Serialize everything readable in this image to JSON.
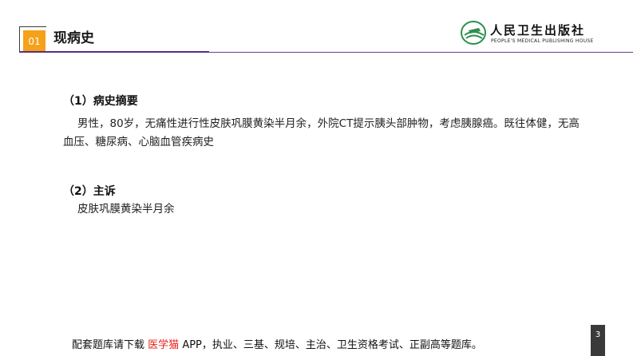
{
  "header": {
    "section_number": "01",
    "section_title": "现病史",
    "colors": {
      "accent_orange": "#f5a11a",
      "rule_purple": "#5b2d83"
    }
  },
  "logo": {
    "icon": "book-emblem-icon",
    "cn_name": "人民卫生出版社",
    "en_name": "PEOPLE'S MEDICAL PUBLISHING HOUSE"
  },
  "content": {
    "section1": {
      "heading": "（1）病史摘要",
      "text": "男性，80岁，无痛性进行性皮肤巩膜黄染半月余，外院CT提示胰头部肿物，考虑胰腺癌。既往体健，无高血压、糖尿病、心脑血管疾病史"
    },
    "section2": {
      "heading": "（2）主诉",
      "text": "皮肤巩膜黄染半月余"
    }
  },
  "footer": {
    "prefix": "配套题库请下载",
    "app_name": "医学猫",
    "suffix": "APP，执业、三基、规培、主治、卫生资格考试、正副高等题库。",
    "app_color": "#e5231b"
  },
  "page_number": "3"
}
